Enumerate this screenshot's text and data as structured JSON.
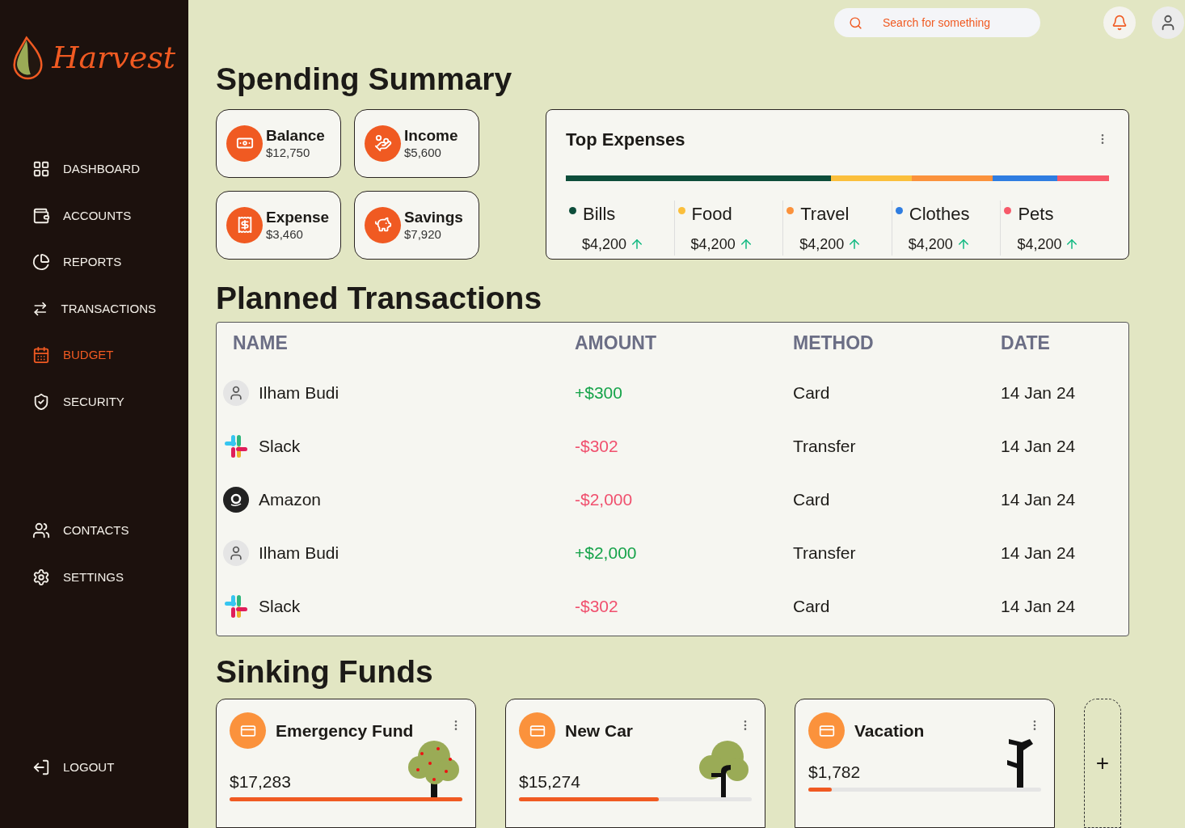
{
  "brand": "Harvest",
  "sidebar": {
    "items": [
      {
        "label": "DASHBOARD",
        "selected": false
      },
      {
        "label": "ACCOUNTS",
        "selected": false
      },
      {
        "label": "REPORTS",
        "selected": false
      },
      {
        "label": "TRANSACTIONS",
        "selected": false
      },
      {
        "label": "BUDGET",
        "selected": true
      },
      {
        "label": "SECURITY",
        "selected": false
      }
    ],
    "bottom_items": [
      {
        "label": "CONTACTS",
        "selected": false
      },
      {
        "label": "SETTINGS",
        "selected": false
      }
    ],
    "logout": "LOGOUT"
  },
  "search": {
    "placeholder": "Search for something"
  },
  "spending_summary": {
    "title": "Spending Summary",
    "cards": [
      {
        "label": "Balance",
        "value": "$12,750"
      },
      {
        "label": "Income",
        "value": "$5,600"
      },
      {
        "label": "Expense",
        "value": "$3,460"
      },
      {
        "label": "Savings",
        "value": "$7,920"
      }
    ]
  },
  "top_expenses": {
    "title": "Top Expenses",
    "items": [
      {
        "name": "Bills",
        "amount": "$4,200",
        "color": "#0d4d3a"
      },
      {
        "name": "Food",
        "amount": "$4,200",
        "color": "#fbbf3c"
      },
      {
        "name": "Travel",
        "amount": "$4,200",
        "color": "#fb923c"
      },
      {
        "name": "Clothes",
        "amount": "$4,200",
        "color": "#2f7de1"
      },
      {
        "name": "Pets",
        "amount": "$4,200",
        "color": "#f75a6a"
      }
    ]
  },
  "planned_transactions": {
    "title": "Planned Transactions",
    "columns": [
      "NAME",
      "AMOUNT",
      "METHOD",
      "DATE"
    ],
    "rows": [
      {
        "kind": "person",
        "name": "Ilham Budi",
        "amount": "+$300",
        "color": "#16a34a",
        "method": "Card",
        "date": "14 Jan 24"
      },
      {
        "kind": "slack",
        "name": "Slack",
        "amount": "-$302",
        "color": "#f0506e",
        "method": "Transfer",
        "date": "14 Jan 24"
      },
      {
        "kind": "amazon",
        "name": "Amazon",
        "amount": "-$2,000",
        "color": "#f0506e",
        "method": "Card",
        "date": "14 Jan 24"
      },
      {
        "kind": "person",
        "name": "Ilham Budi",
        "amount": "+$2,000",
        "color": "#16a34a",
        "method": "Transfer",
        "date": "14 Jan 24"
      },
      {
        "kind": "slack",
        "name": "Slack",
        "amount": "-$302",
        "color": "#f0506e",
        "method": "Card",
        "date": "14 Jan 24"
      }
    ]
  },
  "sinking_funds": {
    "title": "Sinking Funds",
    "add_label": "+",
    "funds": [
      {
        "name": "Emergency Fund",
        "amount": "$17,283",
        "level": 1.0,
        "kind": "fruit"
      },
      {
        "name": "New Car",
        "amount": "$15,274",
        "level": 0.6,
        "kind": "leafy"
      },
      {
        "name": "Vacation",
        "amount": "$1,782",
        "level": 0.1,
        "kind": "bare"
      }
    ]
  }
}
